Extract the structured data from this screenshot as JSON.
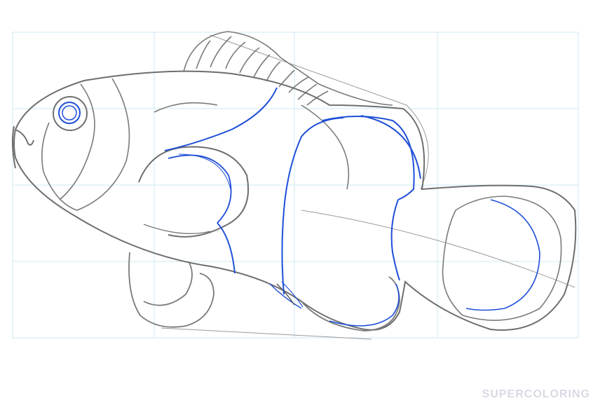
{
  "watermark": {
    "text": "SUPERCOLORING"
  },
  "colors": {
    "background": "#ffffff",
    "grid": "#cfe8f3",
    "pencil": "#7a7a7a",
    "ink_dark": "#555555",
    "blue": "#1f4fd8"
  },
  "drawing": {
    "subject": "clownfish-drawing-icon"
  }
}
